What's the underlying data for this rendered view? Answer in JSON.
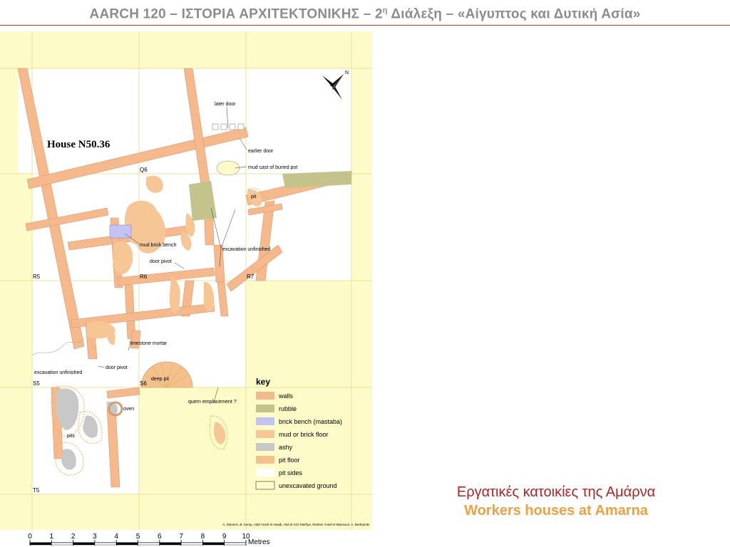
{
  "slide": {
    "title_pre": "AARCH 120 – ΙΣΤΟΡΙΑ ΑΡΧΙΤΕΚΤΟΝΙΚΗΣ – 2",
    "title_sup": "η",
    "title_post": " Διάλεξη – «Αίγυπτος και Δυτική Ασία»",
    "accent_color": "#c0392b"
  },
  "map": {
    "house_label": "House N50.36",
    "north_label": "N",
    "grid_labels": [
      "Q6",
      "R5",
      "R6",
      "R7",
      "S5",
      "S6",
      "T5"
    ],
    "annotations": {
      "later_door": "later door",
      "earlier_door": "earlier door",
      "mud_cast": "mud cast of buried pot",
      "pit": "pit",
      "mud_brick_bench": "mud brick bench",
      "excavation_unfinished_1": "excavation unfinished",
      "door_pivot_1": "door pivot",
      "limestone_mortar": "limestone mortar",
      "door_pivot_2": "door pivot",
      "excavation_unfinished_2": "excavation unfinished",
      "deep_pit": "deep pit",
      "quern": "quern emplacement ?",
      "oven": "oven",
      "pits": "pits"
    },
    "credits": "A. Stevens, B. Kemp, Adel Yusef el Awadi, Abd el Aziz Marfiya, Ibrahim Yusef el Mansouri, A. Bednarski",
    "key": {
      "title": "key",
      "items": [
        {
          "label": "walls",
          "color": "#f6b98c"
        },
        {
          "label": "rubble",
          "color": "#c2c48c"
        },
        {
          "label": "brick bench (mastaba)",
          "color": "#c4c4f4"
        },
        {
          "label": "mud or brick floor",
          "color": "#f6c694"
        },
        {
          "label": "ashy",
          "color": "#c8c8c8"
        },
        {
          "label": "pit floor",
          "color": "#f6c08c"
        },
        {
          "label": "pit sides",
          "color": "#ffffff"
        },
        {
          "label": "unexcavated ground",
          "color": "#fdfbc8"
        }
      ]
    },
    "scale": {
      "ticks": [
        "0",
        "1",
        "2",
        "3",
        "4",
        "5",
        "6",
        "7",
        "8",
        "9",
        "10"
      ],
      "unit": "Metres"
    },
    "colors": {
      "unexcavated": "#fdfbc8",
      "walls": "#f6b98c",
      "floor": "#f6c694",
      "rubble": "#c2c48c",
      "ashy": "#c8c8c8",
      "bench": "#c4c4f4"
    }
  },
  "caption": {
    "greek": "Εργατικές κατοικίες της Αμάρνα",
    "english": "Workers houses at Amarna"
  }
}
